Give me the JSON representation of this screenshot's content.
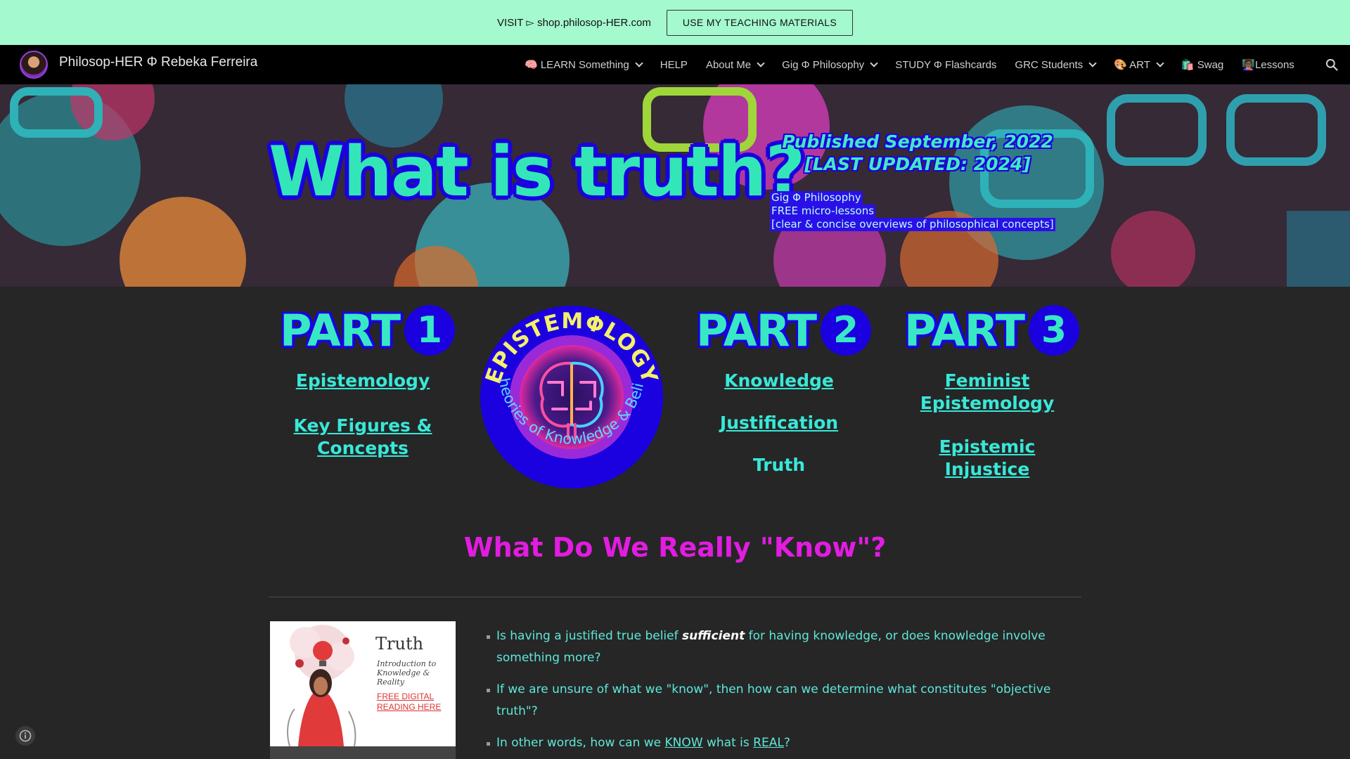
{
  "announcement": {
    "text": "VISIT ▻ shop.philosop-HER.com",
    "button": "USE MY TEACHING MATERIALS"
  },
  "nav": {
    "site_title": "Philosop-HER Φ Rebeka Ferreira",
    "items": [
      {
        "label": "🧠 LEARN Something",
        "dropdown": true
      },
      {
        "label": "HELP",
        "dropdown": false
      },
      {
        "label": "About Me",
        "dropdown": true
      },
      {
        "label": "Gig Φ Philosophy",
        "dropdown": true
      },
      {
        "label": "STUDY Φ Flashcards",
        "dropdown": false
      },
      {
        "label": "GRC Students",
        "dropdown": true
      },
      {
        "label": "🎨 ART",
        "dropdown": true
      },
      {
        "label": "🛍️ Swag",
        "dropdown": false
      },
      {
        "label": "👩🏾‍🏫Lessons",
        "dropdown": false
      }
    ]
  },
  "hero": {
    "title": "What is truth?",
    "published": "Published September, 2022 [LAST UPDATED: 2024]",
    "sub_lines": [
      "Gig Φ Philosophy",
      "FREE micro-lessons",
      "[clear & concise overviews of philosophical concepts]"
    ]
  },
  "parts": {
    "word": "PART",
    "p1": {
      "num": "1",
      "link1": "Epistemology",
      "link2": "Key Figures & Concepts"
    },
    "p2": {
      "num": "2",
      "link1": "Knowledge",
      "link2": "Justification",
      "current": "Truth"
    },
    "p3": {
      "num": "3",
      "link1": "Feminist Epistemology",
      "link2": "Epistemic Injustice"
    }
  },
  "logo": {
    "top_text": "EPISTEMΦLOGY",
    "bottom_text": "Theories of Knowledge & Belief"
  },
  "section": {
    "title": "What Do We Really \"Know\"?"
  },
  "thumbnail": {
    "title": "Truth",
    "subtitle1": "Introduction to",
    "subtitle2": "Knowledge & Reality",
    "cta1": "FREE DIGITAL",
    "cta2": "READING HERE"
  },
  "bullets": {
    "b1_pre": "Is having a justified true belief ",
    "b1_em": "sufficient",
    "b1_post": " for having knowledge, or does knowledge involve something more?",
    "b2": "If we are unsure of what we \"know\", then how can we determine what constitutes \"objective truth\"?",
    "b3_pre": "In other words, how can we ",
    "b3_link1": "KNOW",
    "b3_mid": " what is ",
    "b3_link2": "REAL",
    "b3_post": "?"
  },
  "colors": {
    "announce_bg": "#a4f9cf",
    "nav_bg": "#000000",
    "page_bg": "#262626",
    "accent_teal": "#38e8c4",
    "accent_blue": "#1b00e0",
    "accent_magenta": "#e21ce0"
  },
  "icons": [
    "brain-icon",
    "chevron-down-icon",
    "search-icon",
    "info-icon"
  ]
}
